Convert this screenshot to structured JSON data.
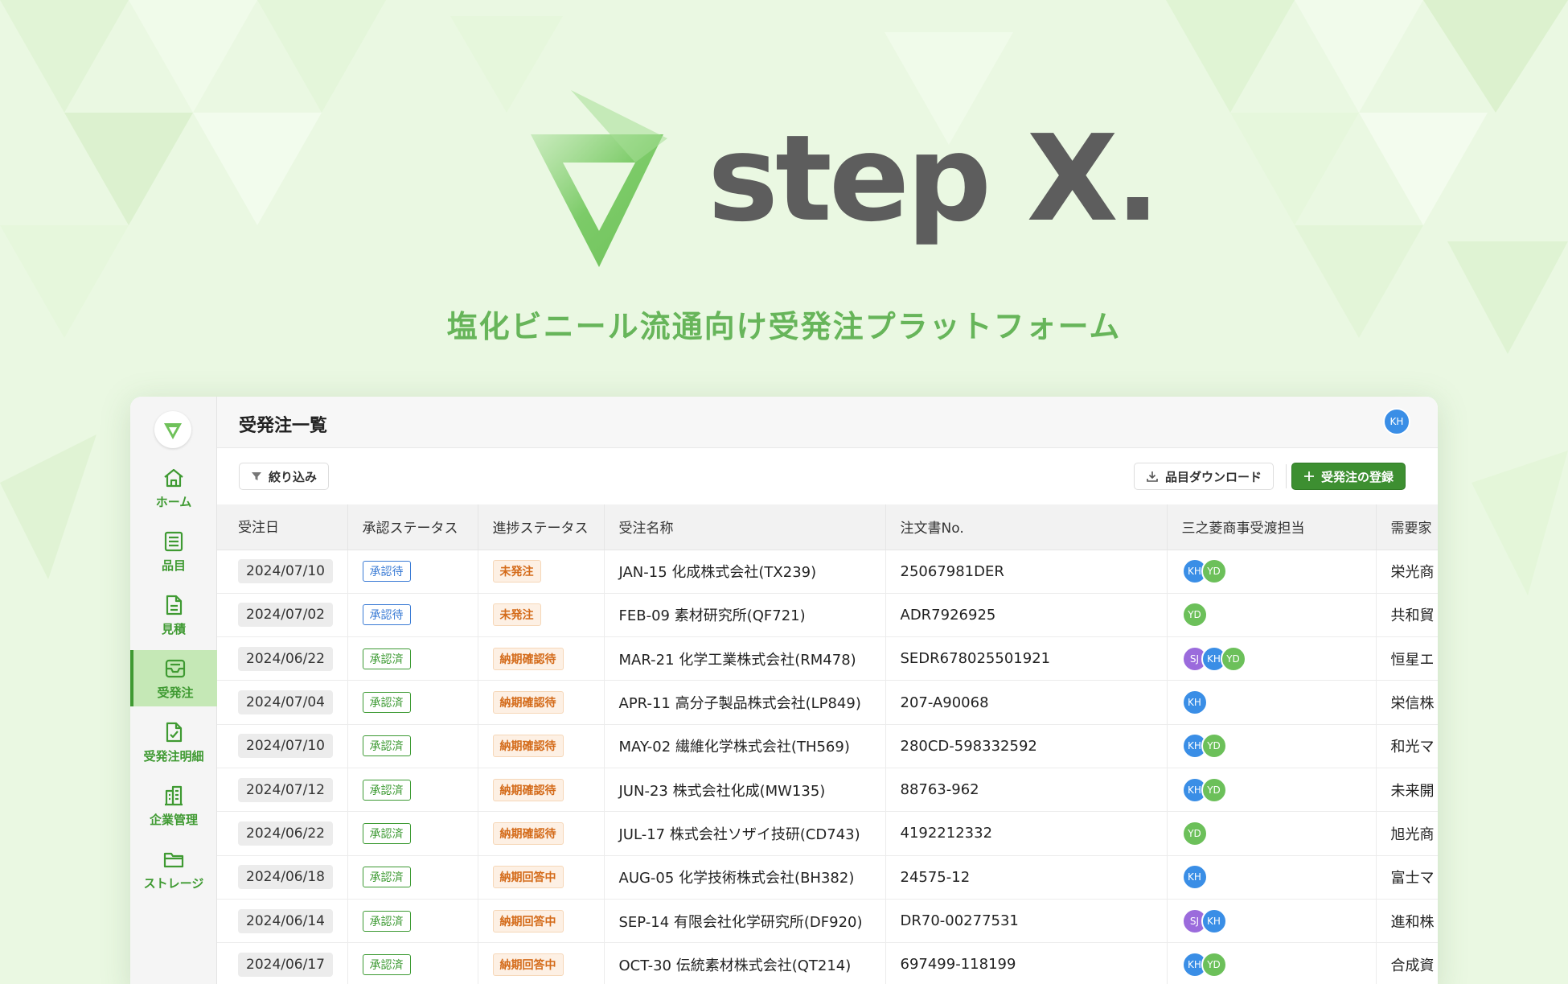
{
  "hero": {
    "wordmark": "step X.",
    "tagline": "塩化ビニール流通向け受発注プラットフォーム"
  },
  "colors": {
    "brand_green": "#3d8f31",
    "accent_green": "#67b55a",
    "avatar_kh": "#3a8ee6",
    "avatar_yd": "#6cc05a",
    "avatar_sj": "#9b6bdc",
    "pending_blue": "#3a7bd5",
    "progress_orange": "#d46b1a"
  },
  "sidebar": {
    "items": [
      {
        "label": "ホーム",
        "icon": "home-icon"
      },
      {
        "label": "品目",
        "icon": "list-icon"
      },
      {
        "label": "見積",
        "icon": "document-icon"
      },
      {
        "label": "受発注",
        "icon": "inbox-icon",
        "active": true
      },
      {
        "label": "受発注明細",
        "icon": "document-check-icon"
      },
      {
        "label": "企業管理",
        "icon": "building-icon"
      },
      {
        "label": "ストレージ",
        "icon": "folder-icon"
      }
    ]
  },
  "header": {
    "title": "受発注一覧",
    "user_avatar": "KH"
  },
  "toolbar": {
    "filter_label": "絞り込み",
    "download_label": "品目ダウンロード",
    "create_label": "受発注の登録"
  },
  "table": {
    "columns": [
      "受注日",
      "承認ステータス",
      "進捗ステータス",
      "受注名称",
      "注文書No.",
      "三之菱商事受渡担当",
      "需要家"
    ],
    "rows": [
      {
        "date": "2024/07/10",
        "approval": "承認待",
        "approval_state": "pending",
        "progress": "未発注",
        "name": "JAN-15 化成株式会社(TX239)",
        "po": "25067981DER",
        "owners": [
          "KH",
          "YD"
        ],
        "customer": "栄光商"
      },
      {
        "date": "2024/07/02",
        "approval": "承認待",
        "approval_state": "pending",
        "progress": "未発注",
        "name": "FEB-09 素材研究所(QF721)",
        "po": "ADR7926925",
        "owners": [
          "YD"
        ],
        "customer": "共和貿"
      },
      {
        "date": "2024/06/22",
        "approval": "承認済",
        "approval_state": "done",
        "progress": "納期確認待",
        "name": "MAR-21 化学工業株式会社(RM478)",
        "po": "SEDR678025501921",
        "owners": [
          "SJ",
          "KH",
          "YD"
        ],
        "customer": "恒星エ"
      },
      {
        "date": "2024/07/04",
        "approval": "承認済",
        "approval_state": "done",
        "progress": "納期確認待",
        "name": "APR-11 高分子製品株式会社(LP849)",
        "po": "207-A90068",
        "owners": [
          "KH"
        ],
        "customer": "栄信株"
      },
      {
        "date": "2024/07/10",
        "approval": "承認済",
        "approval_state": "done",
        "progress": "納期確認待",
        "name": "MAY-02 繊維化学株式会社(TH569)",
        "po": "280CD-598332592",
        "owners": [
          "KH",
          "YD"
        ],
        "customer": "和光マ"
      },
      {
        "date": "2024/07/12",
        "approval": "承認済",
        "approval_state": "done",
        "progress": "納期確認待",
        "name": "JUN-23 株式会社化成(MW135)",
        "po": "88763-962",
        "owners": [
          "KH",
          "YD"
        ],
        "customer": "未来開"
      },
      {
        "date": "2024/06/22",
        "approval": "承認済",
        "approval_state": "done",
        "progress": "納期確認待",
        "name": "JUL-17 株式会社ソザイ技研(CD743)",
        "po": "4192212332",
        "owners": [
          "YD"
        ],
        "customer": "旭光商"
      },
      {
        "date": "2024/06/18",
        "approval": "承認済",
        "approval_state": "done",
        "progress": "納期回答中",
        "name": "AUG-05 化学技術株式会社(BH382)",
        "po": "24575-12",
        "owners": [
          "KH"
        ],
        "customer": "富士マ"
      },
      {
        "date": "2024/06/14",
        "approval": "承認済",
        "approval_state": "done",
        "progress": "納期回答中",
        "name": "SEP-14 有限会社化学研究所(DF920)",
        "po": "DR70-00277531",
        "owners": [
          "SJ",
          "KH"
        ],
        "customer": "進和株"
      },
      {
        "date": "2024/06/17",
        "approval": "承認済",
        "approval_state": "done",
        "progress": "納期回答中",
        "name": "OCT-30 伝統素材株式会社(QT214)",
        "po": "697499-118199",
        "owners": [
          "KH",
          "YD"
        ],
        "customer": "合成資"
      }
    ]
  }
}
